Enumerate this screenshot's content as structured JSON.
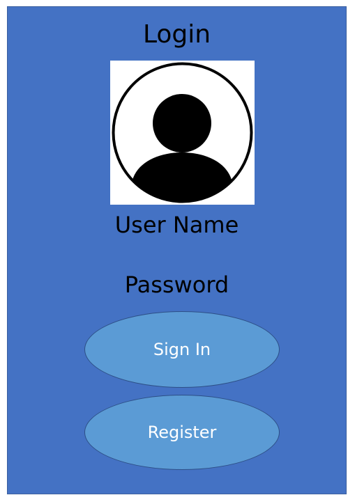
{
  "colors": {
    "background": "#4472c4",
    "button_fill": "#5b9bd5",
    "avatar_dark": "#000000",
    "avatar_bg": "#ffffff"
  },
  "login": {
    "title": "Login",
    "avatar_icon": "user-avatar-icon",
    "username_label": "User Name",
    "password_label": "Password",
    "signin_label": "Sign In",
    "register_label": "Register"
  }
}
